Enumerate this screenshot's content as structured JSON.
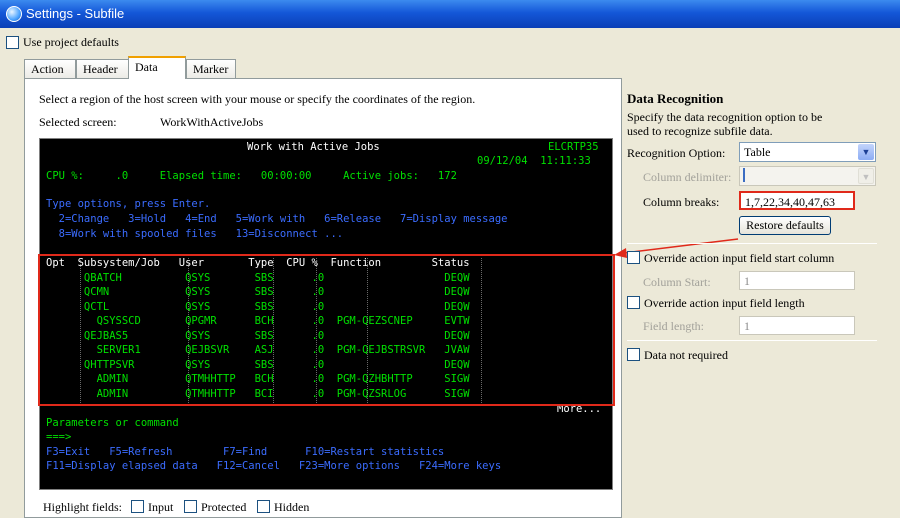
{
  "window": {
    "title": "Settings - Subfile"
  },
  "use_project_defaults": "Use project defaults",
  "tabs": [
    "Action",
    "Header",
    "Data",
    "Marker"
  ],
  "instruction": "Select a region of the host screen with your mouse or specify the coordinates of the region.",
  "selected_screen": {
    "label": "Selected screen:",
    "value": "WorkWithActiveJobs"
  },
  "terminal": {
    "title": "Work with Active Jobs",
    "system": "ELCRTP35",
    "datetime": "09/12/04  11:11:33",
    "cpu": "CPU %:     .0     Elapsed time:   00:00:00     Active jobs:   172",
    "type_options": "Type options, press Enter.",
    "options_line1": "  2=Change   3=Hold   4=End   5=Work with   6=Release   7=Display message",
    "options_line2": "  8=Work with spooled files   13=Disconnect ...",
    "header": "Opt  Subsystem/Job   User       Type  CPU %  Function        Status",
    "rows": [
      "      QBATCH          QSYS       SBS      .0                   DEQW",
      "      QCMN            QSYS       SBS      .0                   DEQW",
      "      QCTL            QSYS       SBS      .0                   DEQW",
      "        QSYSSCD       QPGMR      BCH      .0  PGM-QEZSCNEP     EVTW",
      "      QEJBAS5         QSYS       SBS      .0                   DEQW",
      "        SERVER1       QEJBSVR    ASJ      .0  PGM-QEJBSTRSVR   JVAW",
      "      QHTTPSVR        QSYS       SBS      .0                   DEQW",
      "        ADMIN         QTMHHTTP   BCH      .0  PGM-QZHBHTTP     SIGW",
      "        ADMIN         QTMHHTTP   BCI      .0  PGM-QZSRLOG      SIGW"
    ],
    "more": "More...",
    "params": "Parameters or command",
    "prompt": "===>",
    "fkeys1": "F3=Exit   F5=Refresh        F7=Find      F10=Restart statistics",
    "fkeys2": "F11=Display elapsed data   F12=Cancel   F23=More options   F24=More keys"
  },
  "highlight": {
    "label": "Highlight fields:",
    "input": "Input",
    "protected": "Protected",
    "hidden": "Hidden"
  },
  "recognition": {
    "title": "Data Recognition",
    "description_line1": "Specify the data recognition option to be",
    "description_line2": "used to recognize subfile data.",
    "option_label": "Recognition Option:",
    "option_value": "Table",
    "column_delimiter_label": "Column delimiter:",
    "column_breaks_label": "Column breaks:",
    "column_breaks_value": "1,7,22,34,40,47,63",
    "restore_defaults": "Restore defaults",
    "override_start_column": "Override action input field start column",
    "column_start_label": "Column Start:",
    "column_start_value": "1",
    "override_field_length": "Override action input field length",
    "field_length_label": "Field length:",
    "field_length_value": "1",
    "data_not_required": "Data not required"
  },
  "colors": {
    "title_bar": "#0a3fb6",
    "terminal_bg": "#000000",
    "terminal_green": "#00e000",
    "terminal_blue": "#3b6cff",
    "highlight_red": "#e0291a"
  },
  "icons": {
    "app": "settings-app-icon",
    "dropdown": "chevron-down-icon",
    "arrow": "pointer-arrow-icon"
  }
}
